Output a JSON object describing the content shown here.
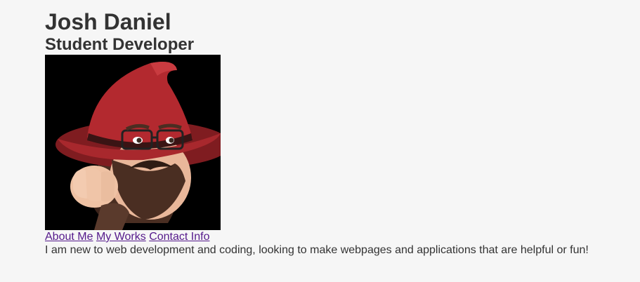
{
  "header": {
    "name": "Josh Daniel",
    "title": "Student Developer"
  },
  "avatar": {
    "alt": "Josh Daniel avatar",
    "icon": "wizard-memoji-avatar"
  },
  "nav": {
    "links": [
      {
        "label": "About Me"
      },
      {
        "label": "My Works"
      },
      {
        "label": "Contact Info"
      }
    ],
    "link_color": "#551a8b"
  },
  "bio": {
    "text": "I am new to web development and coding, looking to make webpages and applications that are helpful or fun!"
  },
  "colors": {
    "background": "#f6f6f6",
    "text": "#333333",
    "hat": "#a8282d"
  }
}
